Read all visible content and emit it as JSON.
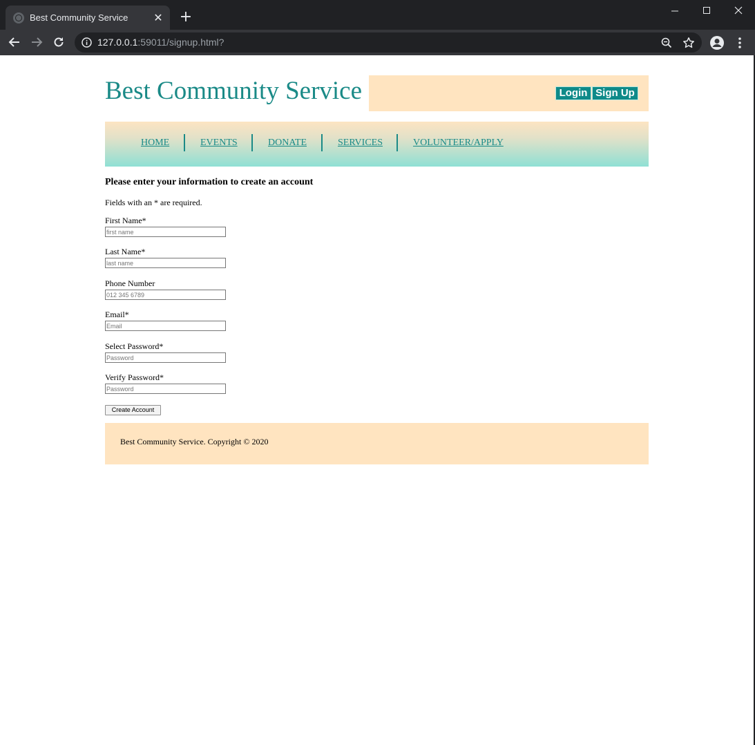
{
  "browser": {
    "tab_title": "Best Community Service",
    "new_tab_label": "+",
    "url_host": "127.0.0.1",
    "url_rest": ":59011/signup.html?"
  },
  "site": {
    "title": "Best Community Service",
    "login_label": "Login",
    "signup_label": "Sign Up"
  },
  "nav": {
    "items": [
      {
        "label": "HOME"
      },
      {
        "label": "EVENTS"
      },
      {
        "label": "DONATE"
      },
      {
        "label": "SERVICES"
      },
      {
        "label": "VOLUNTEER/APPLY"
      }
    ]
  },
  "form": {
    "heading": "Please enter your information to create an account",
    "note": "Fields with an * are required.",
    "fields": [
      {
        "label": "First Name*",
        "placeholder": "first name"
      },
      {
        "label": "Last Name*",
        "placeholder": "last name"
      },
      {
        "label": "Phone Number",
        "placeholder": "012 345 6789"
      },
      {
        "label": "Email*",
        "placeholder": "Email"
      },
      {
        "label": "Select Password*",
        "placeholder": "Password"
      },
      {
        "label": "Verify Password*",
        "placeholder": "Password"
      }
    ],
    "submit_label": "Create Account"
  },
  "footer": {
    "text": "Best Community Service. Copyright © 2020"
  },
  "colors": {
    "brand_teal": "#1a8a87",
    "peach": "#ffe4c0",
    "button_teal": "#0e8a89"
  }
}
